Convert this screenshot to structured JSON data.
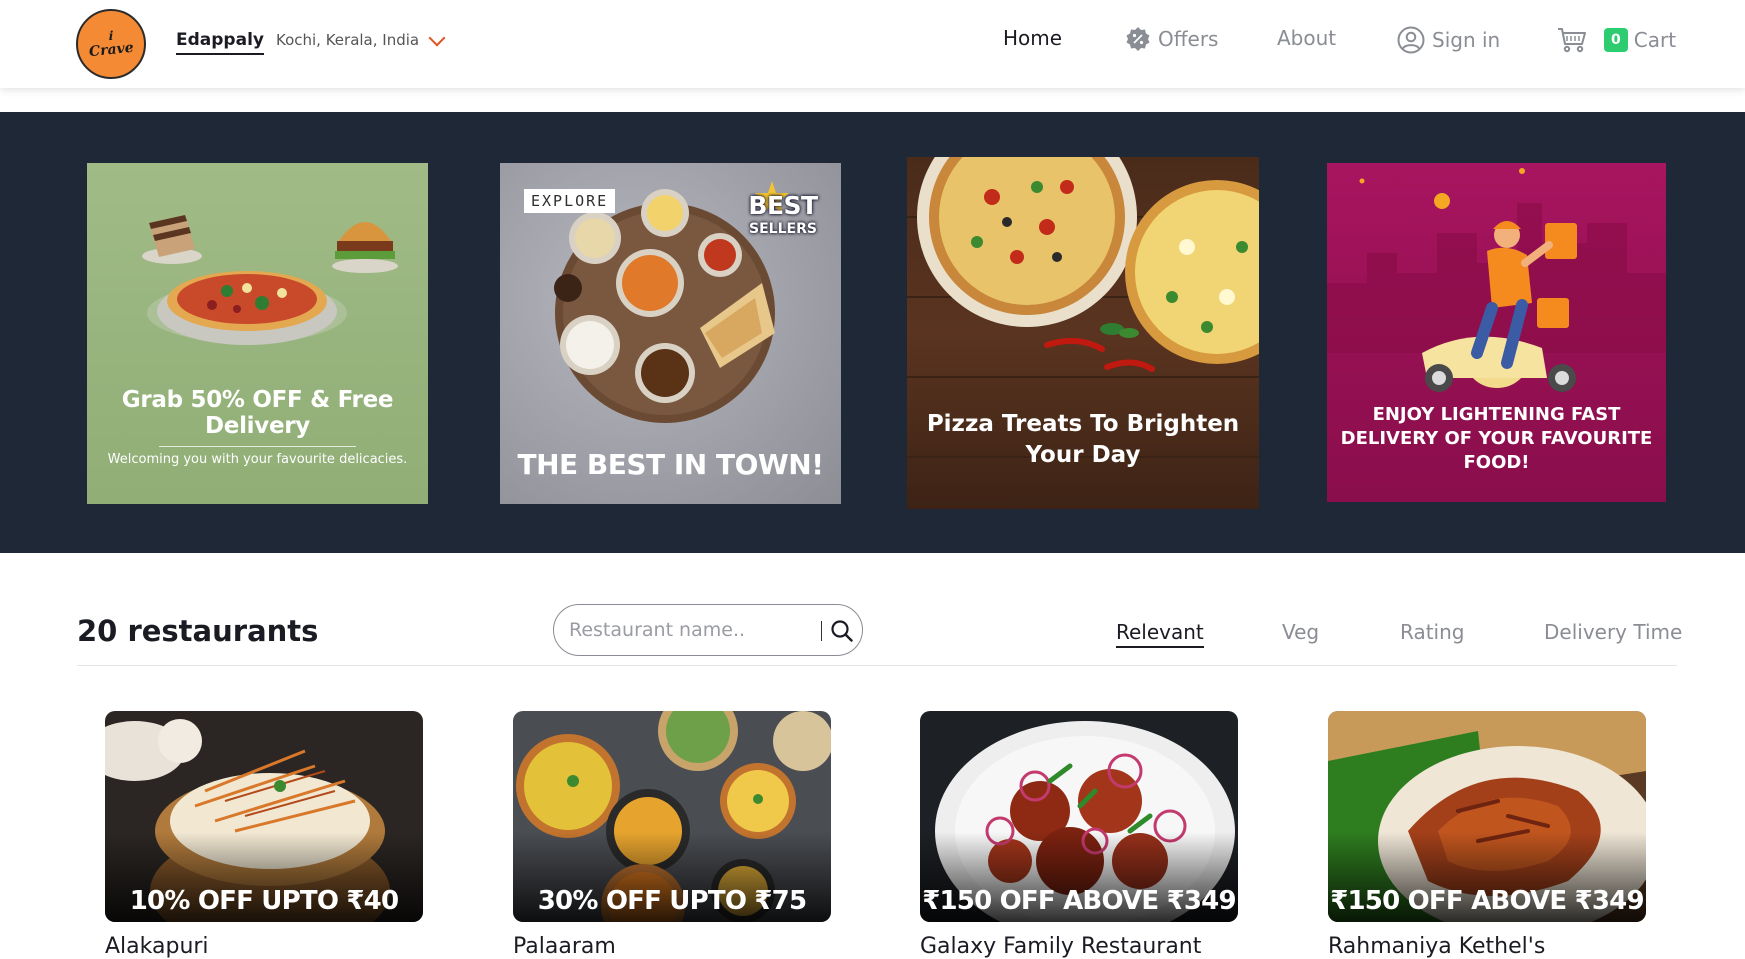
{
  "brand": {
    "logo_top": "i",
    "logo_bottom": "Crave"
  },
  "location": {
    "city": "Edappaly",
    "region": "Kochi, Kerala, India"
  },
  "nav": {
    "home": "Home",
    "offers": "Offers",
    "about": "About",
    "signin": "Sign in",
    "cart_count": "0",
    "cart": "Cart"
  },
  "banners": [
    {
      "title": "Grab 50% OFF & Free Delivery",
      "subtitle": "Welcoming you with your favourite delicacies."
    },
    {
      "tag": "EXPLORE",
      "badge_top": "BEST",
      "badge_bottom": "SELLERS",
      "title": "THE BEST IN TOWN!"
    },
    {
      "title": "Pizza Treats To Brighten Your Day"
    },
    {
      "title": "ENJOY LIGHTENING FAST DELIVERY OF YOUR FAVOURITE FOOD!"
    }
  ],
  "listing": {
    "count_label": "20 restaurants",
    "search_placeholder": "Restaurant name..",
    "sort_options": [
      "Relevant",
      "Veg",
      "Rating",
      "Delivery Time"
    ],
    "active_sort": "Relevant"
  },
  "restaurants": [
    {
      "name": "Alakapuri",
      "offer": "10% OFF UPTO ₹40"
    },
    {
      "name": "Palaaram",
      "offer": "30% OFF UPTO ₹75"
    },
    {
      "name": "Galaxy Family Restaurant",
      "offer": "₹150 OFF ABOVE ₹349"
    },
    {
      "name": "Rahmaniya Kethel's",
      "offer": "₹150 OFF ABOVE ₹349"
    }
  ],
  "colors": {
    "brand_orange": "#f58a34",
    "hero_bg": "#1f2837",
    "cart_badge": "#2ecc71",
    "location_chevron": "#e0531f"
  },
  "icons": [
    "chevron-down-icon",
    "offers-badge-icon",
    "user-circle-icon",
    "cart-icon",
    "search-icon"
  ]
}
